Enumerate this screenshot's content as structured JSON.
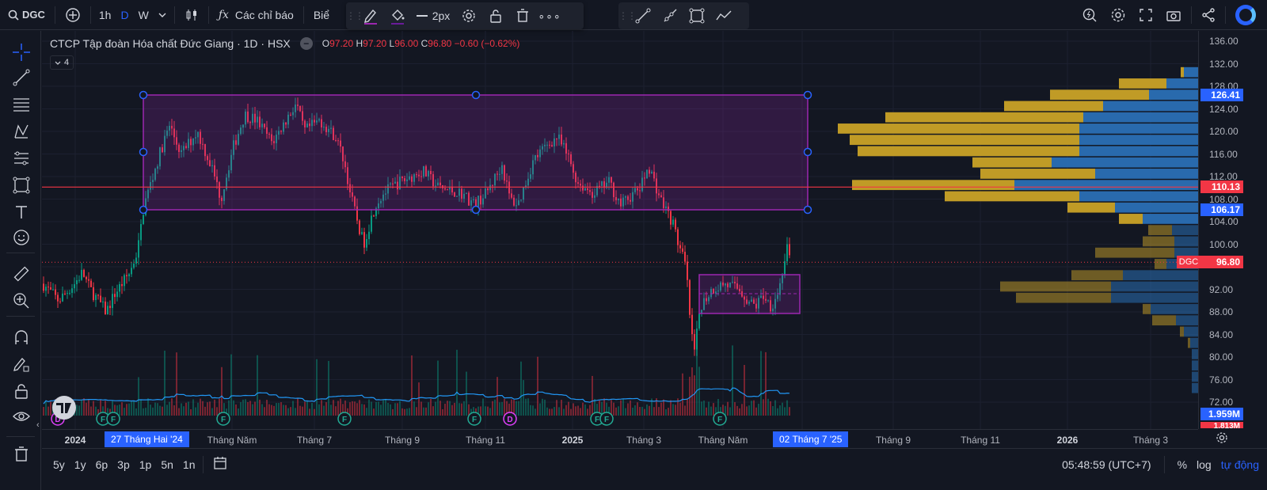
{
  "toolbar": {
    "symbol": "DGC",
    "intervals": [
      "1h",
      "D",
      "W"
    ],
    "indicators_label": "Các chỉ báo",
    "truncated_label": "Biể",
    "stroke_width_label": "2px"
  },
  "legend": {
    "title": "CTCP Tập đoàn Hóa chất Đức Giang · 1D · HSX",
    "o_label": "O",
    "o_value": "97.20",
    "h_label": "H",
    "h_value": "97.20",
    "l_label": "L",
    "l_value": "96.00",
    "c_label": "C",
    "c_value": "96.80",
    "change": "−0.60 (−0.62%)",
    "indicator_count": "4"
  },
  "price_axis": {
    "labels": [
      "136.00",
      "132.00",
      "128.00",
      "124.00",
      "120.00",
      "116.00",
      "112.00",
      "108.00",
      "104.00",
      "100.00",
      "92.00",
      "88.00",
      "84.00",
      "80.00",
      "76.00",
      "72.00"
    ],
    "tags": [
      {
        "value": "126.41",
        "color": "#2962ff"
      },
      {
        "value": "110.13",
        "color": "#f23645"
      },
      {
        "value": "106.17",
        "color": "#2962ff"
      },
      {
        "value": "96.80",
        "color": "#f23645"
      },
      {
        "value": "1.959M",
        "color": "#2962ff"
      },
      {
        "value": "1.813M",
        "color": "#f23645"
      }
    ],
    "symbol_tag": "DGC"
  },
  "time_axis": {
    "labels": [
      {
        "text": "2024",
        "bold": true
      },
      {
        "text": "Tháng Năm",
        "bold": false
      },
      {
        "text": "Tháng 7",
        "bold": false
      },
      {
        "text": "Tháng 9",
        "bold": false
      },
      {
        "text": "Tháng 11",
        "bold": false
      },
      {
        "text": "2025",
        "bold": true
      },
      {
        "text": "Tháng 3",
        "bold": false
      },
      {
        "text": "Tháng Năm",
        "bold": false
      },
      {
        "text": "Tháng 9",
        "bold": false
      },
      {
        "text": "Tháng 11",
        "bold": false
      },
      {
        "text": "2026",
        "bold": true
      },
      {
        "text": "Tháng 3",
        "bold": false
      }
    ],
    "highlight_start": "27 Tháng Hai '24",
    "highlight_end": "02 Tháng 7 '25"
  },
  "event_markers": [
    "D",
    "F",
    "F",
    "F",
    "F",
    "F",
    "D",
    "F",
    "F",
    "F"
  ],
  "bottom": {
    "ranges": [
      "5y",
      "1y",
      "6p",
      "3p",
      "1p",
      "5n",
      "1n"
    ],
    "clock": "05:48:59 (UTC+7)",
    "percent": "%",
    "log": "log",
    "auto": "tự động"
  },
  "colors": {
    "up": "#089981",
    "down": "#f23645",
    "rect_stroke": "#9c27b0",
    "rect_fill": "rgba(156,39,176,0.22)",
    "handle": "#2962ff",
    "vp_up": "#2a6fb5",
    "vp_down": "#c9a227"
  }
}
